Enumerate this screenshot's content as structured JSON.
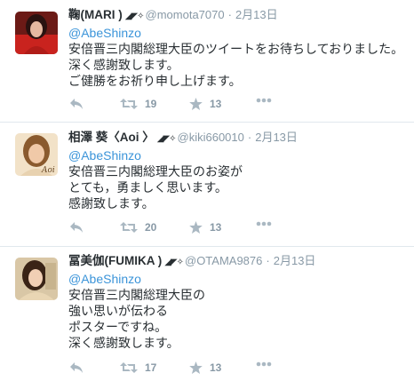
{
  "tweets": [
    {
      "name": "鞠(MARI )",
      "badge": "◢◤✧",
      "handle": "@momota7070",
      "separator": "·",
      "date": "2月13日",
      "mention": "@AbeShinzo",
      "lines": [
        "安倍晋三内閣総理大臣のツイートをお待ちしておりました。",
        "深く感謝致します。",
        "ご健勝をお祈り申し上げます。"
      ],
      "retweets": "19",
      "favorites": "13"
    },
    {
      "name": "相澤 葵〈Aoi 〉",
      "badge": "◢◤✧",
      "handle": "@kiki660010",
      "separator": "·",
      "date": "2月13日",
      "mention": "@AbeShinzo",
      "lines": [
        "安倍晋三内閣総理大臣のお姿が",
        "とても，勇ましく思います。",
        "感謝致します。"
      ],
      "retweets": "20",
      "favorites": "13"
    },
    {
      "name": "冨美伽(FUMIKA )",
      "badge": "◢◤✧",
      "handle": "@OTAMA9876",
      "separator": "·",
      "date": "2月13日",
      "mention": "@AbeShinzo",
      "lines": [
        "安倍晋三内閣総理大臣の",
        "強い思いが伝わる",
        "ポスターですね。",
        "深く感謝致します。"
      ],
      "retweets": "17",
      "favorites": "13"
    }
  ],
  "colors": {
    "link": "#3b94d9",
    "muted": "#8899a6",
    "icon": "#aab8c2",
    "divider": "#e1e8ed"
  },
  "icons": [
    "reply-icon",
    "retweet-icon",
    "favorite-icon",
    "more-icon"
  ]
}
